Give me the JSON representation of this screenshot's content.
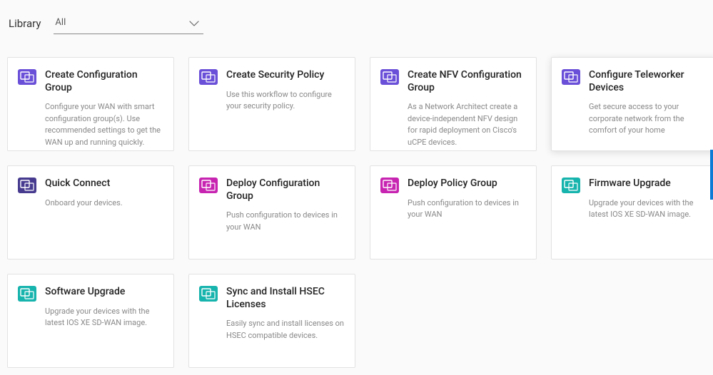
{
  "header": {
    "label": "Library",
    "filter_value": "All"
  },
  "icon_colors": {
    "purple_dark": "icon-purple-dark",
    "purple_darker": "icon-purple-darker",
    "magenta": "icon-magenta",
    "teal": "icon-teal"
  },
  "cards": [
    {
      "title": "Create Configuration Group",
      "desc": "Configure your WAN with smart configuration group(s). Use recommended settings to get the WAN up and running quickly.",
      "icon": "purple_dark",
      "name": "card-create-configuration-group",
      "selected": false
    },
    {
      "title": "Create Security Policy",
      "desc": "Use this workflow to configure your security policy.",
      "icon": "purple_dark",
      "name": "card-create-security-policy",
      "selected": false
    },
    {
      "title": "Create NFV Configuration Group",
      "desc": "As a Network Architect create a device-independent NFV design for rapid deployment on Cisco's uCPE devices.",
      "icon": "purple_dark",
      "name": "card-create-nfv-configuration-group",
      "selected": false
    },
    {
      "title": "Configure Teleworker Devices",
      "desc": "Get secure access to your corporate network from the comfort of your home",
      "icon": "purple_dark",
      "name": "card-configure-teleworker-devices",
      "selected": true
    },
    {
      "title": "Quick Connect",
      "desc": "Onboard your devices.",
      "icon": "purple_darker",
      "name": "card-quick-connect",
      "selected": false
    },
    {
      "title": "Deploy Configuration Group",
      "desc": "Push configuration to devices in your WAN",
      "icon": "magenta",
      "name": "card-deploy-configuration-group",
      "selected": false
    },
    {
      "title": "Deploy Policy Group",
      "desc": "Push configuration to devices in your WAN",
      "icon": "magenta",
      "name": "card-deploy-policy-group",
      "selected": false
    },
    {
      "title": "Firmware Upgrade",
      "desc": "Upgrade your devices with the latest IOS XE SD-WAN image.",
      "icon": "teal",
      "name": "card-firmware-upgrade",
      "selected": false
    },
    {
      "title": "Software Upgrade",
      "desc": "Upgrade your devices with the latest IOS XE SD-WAN image.",
      "icon": "teal",
      "name": "card-software-upgrade",
      "selected": false
    },
    {
      "title": "Sync and Install HSEC Licenses",
      "desc": "Easily sync and install licenses on HSEC compatible devices.",
      "icon": "teal",
      "name": "card-sync-install-hsec-licenses",
      "selected": false
    }
  ]
}
